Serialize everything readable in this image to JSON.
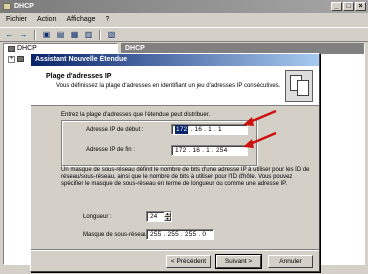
{
  "main_window": {
    "title": "DHCP",
    "win_buttons": [
      "_",
      "□",
      "×"
    ],
    "menu": [
      "Fichier",
      "Action",
      "Affichage",
      "?"
    ],
    "tree": [
      {
        "label": "DHCP",
        "expander": ""
      },
      {
        "label": "",
        "expander": "+"
      }
    ],
    "right_header": "DHCP"
  },
  "wizard": {
    "title": "Assistant Nouvelle Étendue",
    "header_title": "Plage d'adresses IP",
    "header_desc": "Vous définissez la plage d'adresses en identifiant un jeu d'adresses IP consécutives.",
    "intro": "Entrez la plage d'adresses que l'étendue peut distribuer.",
    "start_label": "Adresse IP de début :",
    "start_ip_selected": "172",
    "start_ip_rest": ". 16 . 1 . 1",
    "end_label": "Adresse IP de fin :",
    "end_ip": "172 . 16 . 1 . 254",
    "paragraph": "Un masque de sous-réseau définit le nombre de bits d'une adresse IP à utiliser pour les ID de réseau/sous-réseau, ainsi que le nombre de bits à utiliser pour l'ID d'hôte. Vous pouvez spécifier le masque de sous-réseau en terme de longueur ou comme une adresse IP.",
    "length_label": "Longueur :",
    "length_value": "24",
    "mask_label": "Masque de sous-réseau :",
    "mask_value": "255 . 255 . 255 . 0",
    "btn_back": "< Précédent",
    "btn_next": "Suivant >",
    "btn_cancel": "Annuler"
  },
  "colors": {
    "arrow": "#cc1010",
    "title_active": "#0a246a"
  }
}
